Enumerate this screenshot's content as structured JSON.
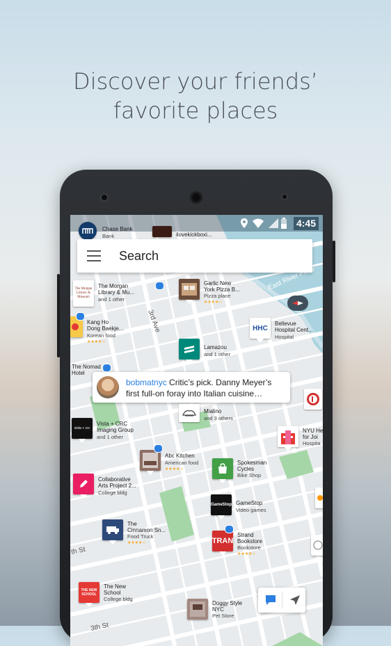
{
  "headline": {
    "line1": "Discover your friends’",
    "line2": "favorite places"
  },
  "status_bar": {
    "time": "4:45",
    "icons": [
      "location-icon",
      "wifi-icon",
      "signal-icon",
      "battery-icon"
    ]
  },
  "search": {
    "placeholder": "Search",
    "menu_icon": "hamburger-menu-icon"
  },
  "top_places": [
    {
      "name": "Chase Bank",
      "category": "Bank"
    },
    {
      "name": "ilovekickboxi..."
    }
  ],
  "places": [
    {
      "name1": "The Morgan",
      "name2": "Library & Mu...",
      "sub": "and 1 other",
      "tile_text": "The Morgan Library & Museum"
    },
    {
      "name1": "Garlic New",
      "name2": "York Pizza B...",
      "sub": "Pizza place"
    },
    {
      "name1": "Kang Ho",
      "name2": "Dong Baekje...",
      "sub": "Korean food"
    },
    {
      "name1": "Bellevue",
      "name2": "Hospital Cent...",
      "sub": "Hospital",
      "tile_text": "HHC"
    },
    {
      "name1": "Lamazou",
      "sub": "and 1 other"
    },
    {
      "name1": "The Nomad",
      "name2": "Hotel"
    },
    {
      "name1": "Mialino",
      "sub": "and 3 others"
    },
    {
      "name1": "Vista + CRC",
      "name2": "Imaging Group",
      "sub": "and 1 other",
      "tile_text": "vista + crc"
    },
    {
      "name1": "NYU He",
      "name2": "for Joi",
      "sub": "Hospita"
    },
    {
      "name1": "Abc Kitchen",
      "sub": "American food"
    },
    {
      "name1": "Spokesman",
      "name2": "Cycles",
      "sub": "Bike Shop"
    },
    {
      "name1": "Collaborative",
      "name2": "Arts Project 2...",
      "sub": "College bldg"
    },
    {
      "name1": "GameStop",
      "sub": "Video games",
      "tile_text": "GameStop"
    },
    {
      "name1": "The",
      "name2": "Cinnamon Sn...",
      "sub": "Food Truck"
    },
    {
      "name1": "Strand",
      "name2": "Bookstore",
      "sub": "Bookstore",
      "tile_text": "TRAN"
    },
    {
      "name1": "The New",
      "name2": "School",
      "sub": "College bldg",
      "tile_text": "THE NEW SCHOOL"
    },
    {
      "name1": "Doggy Style",
      "name2": "NYC",
      "sub": "Pet Store"
    }
  ],
  "callout": {
    "username": "bobmatnyc",
    "text1": "Critic’s pick.  Danny Meyer’s",
    "text2": "first full-on foray into Italian cuisine…"
  },
  "map_labels": {
    "street1": "3rd Ave",
    "river": "East River Ferry",
    "street2": "th St",
    "street3": "3th St"
  },
  "colors": {
    "map_land": "#eceff1",
    "water": "#aad3df",
    "park": "#a5d6a7",
    "accent": "#2b7fe0",
    "stars": "#f5a623"
  }
}
